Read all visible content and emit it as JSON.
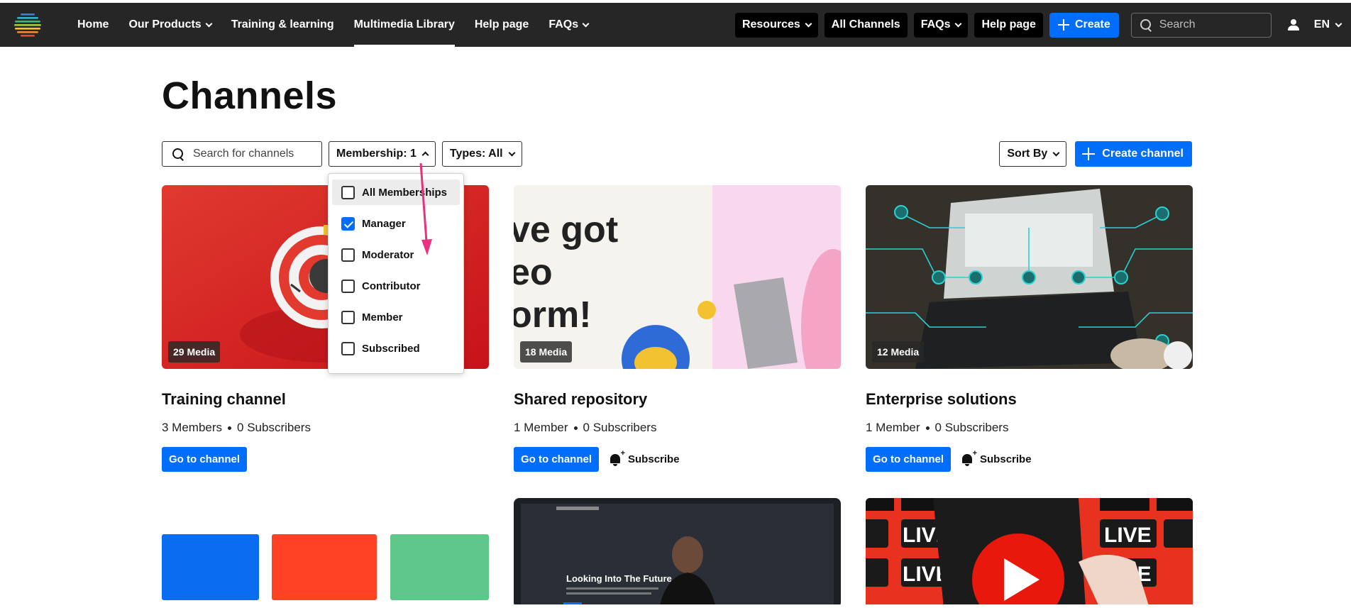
{
  "nav": {
    "items": [
      {
        "label": "Home",
        "dropdown": false
      },
      {
        "label": "Our Products",
        "dropdown": true
      },
      {
        "label": "Training & learning",
        "dropdown": false
      },
      {
        "label": "Multimedia Library",
        "dropdown": false,
        "active": true
      },
      {
        "label": "Help page",
        "dropdown": false
      },
      {
        "label": "FAQs",
        "dropdown": true
      }
    ],
    "right": {
      "resources": "Resources",
      "all_channels": "All Channels",
      "faqs": "FAQs",
      "help_page": "Help page",
      "create": "Create",
      "search_placeholder": "Search",
      "language": "EN"
    }
  },
  "page": {
    "title": "Channels",
    "search_placeholder": "Search for channels",
    "membership_filter": "Membership: 1",
    "types_filter": "Types: All",
    "sort_by": "Sort By",
    "create_channel": "Create channel"
  },
  "membership_dropdown": {
    "options": [
      {
        "label": "All Memberships",
        "checked": false
      },
      {
        "label": "Manager",
        "checked": true
      },
      {
        "label": "Moderator",
        "checked": false
      },
      {
        "label": "Contributor",
        "checked": false
      },
      {
        "label": "Member",
        "checked": false
      },
      {
        "label": "Subscribed",
        "checked": false
      }
    ]
  },
  "channels": [
    {
      "title": "Training channel",
      "media": "29 Media",
      "members": "3 Members",
      "subscribers": "0 Subscribers",
      "go": "Go to channel",
      "subscribe": ""
    },
    {
      "title": "Shared repository",
      "media": "18 Media",
      "members": "1 Member",
      "subscribers": "0 Subscribers",
      "go": "Go to channel",
      "subscribe": "Subscribe",
      "thumb_text": [
        "ve got",
        "eo",
        "orm!"
      ]
    },
    {
      "title": "Enterprise solutions",
      "media": "12 Media",
      "members": "1 Member",
      "subscribers": "0 Subscribers",
      "go": "Go to channel",
      "subscribe": "Subscribe"
    }
  ],
  "lower_thumbs": {
    "future_text": "Looking Into The Future",
    "live_text": "LIVE"
  },
  "colors": {
    "accent": "#006efa",
    "topbar": "#262626",
    "arrow": "#e8327f"
  }
}
